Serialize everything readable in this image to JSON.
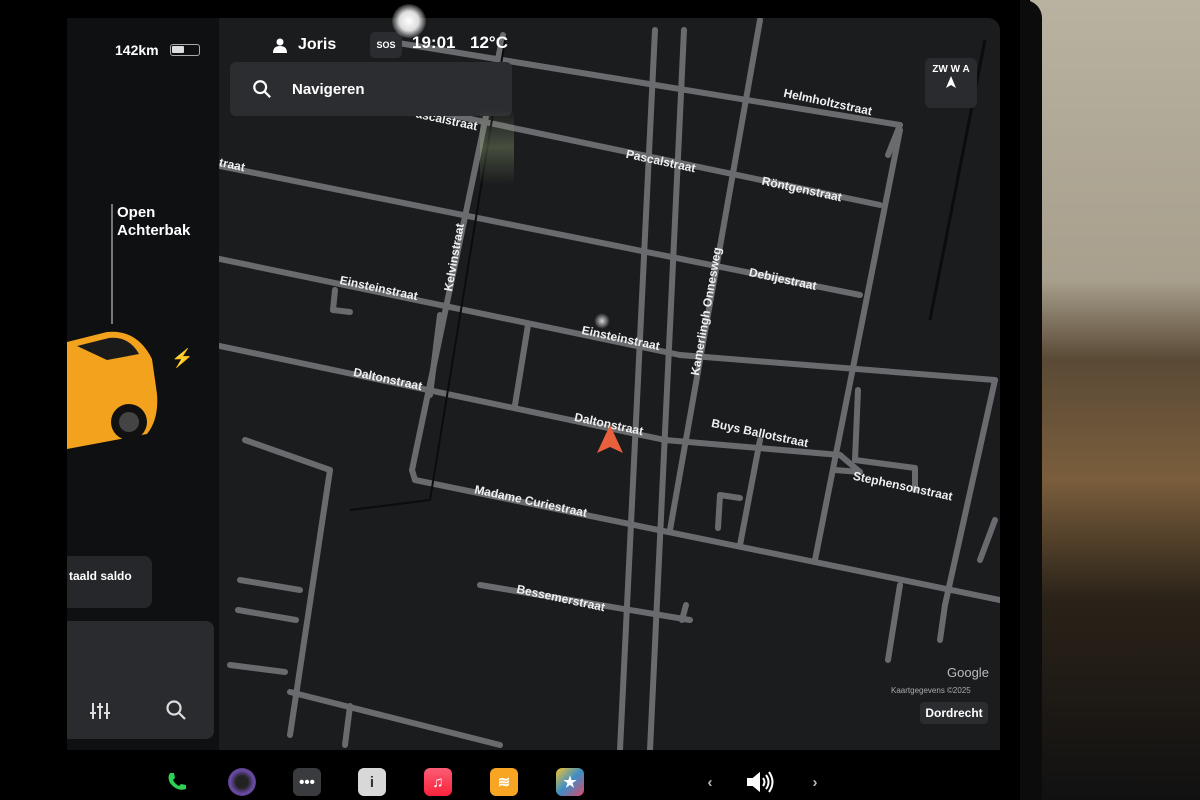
{
  "status": {
    "range": "142km",
    "driver": "Joris",
    "sos": "SOS",
    "time": "19:01",
    "temperature": "12°C"
  },
  "search": {
    "placeholder": "Navigeren"
  },
  "compass": {
    "label": "ZW W A"
  },
  "vehicle": {
    "trunk_label": "Open\nAchterbak",
    "charge_icon": "bolt-icon",
    "body_color": "#f2a21c"
  },
  "cards": {
    "saldo_label": "taald saldo"
  },
  "map": {
    "streets": [
      "Pascalstraat",
      "Helmholtzstraat",
      "Pascalstraat",
      "Röntgenstraat",
      "straat",
      "Kelvinstraat",
      "Debijestraat",
      "Einsteinstraat",
      "Kamerlingh Onnesweg",
      "Einsteinstraat",
      "Daltonstraat",
      "Daltonstraat",
      "Buys Ballotstraat",
      "Stephensonstraat",
      "Madame Curiestraat",
      "Bessemerstraat"
    ],
    "attribution_brand": "Google",
    "attribution_text": "Kaartgegevens ©2025",
    "city": "Dordrecht",
    "position_marker_color": "#e8603c"
  },
  "dock": {
    "icons": [
      "phone-icon",
      "camera-icon",
      "more-icon",
      "manual-icon",
      "music-icon",
      "audible-icon",
      "toybox-icon"
    ],
    "nav_prev": "‹",
    "nav_next": "›",
    "volume_icon": "speaker-icon"
  }
}
